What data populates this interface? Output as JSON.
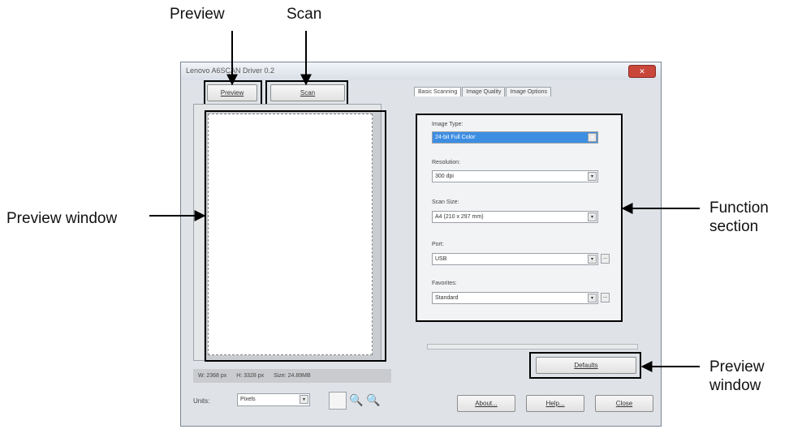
{
  "callouts": {
    "preview": "Preview",
    "scan": "Scan",
    "preview_window": "Preview window",
    "function_section_line1": "Function",
    "function_section_line2": "section",
    "preview_window2_line1": "Preview",
    "preview_window2_line2": "window"
  },
  "window": {
    "title": "Lenovo A6SCAN Driver 0.2",
    "close_glyph": "✕"
  },
  "toolbar": {
    "preview_label": "Preview",
    "scan_label": "Scan"
  },
  "status": {
    "width": "W: 2368 px",
    "height": "H: 3328 px",
    "size": "Size: 24.89MB"
  },
  "units": {
    "label": "Units:",
    "value": "Pixels"
  },
  "tabs": [
    "Basic Scanning",
    "Image Quality",
    "Image Options"
  ],
  "fields": {
    "image_type": {
      "label": "Image Type:",
      "value": "24-bit Full Color"
    },
    "resolution": {
      "label": "Resolution:",
      "value": "300 dpi"
    },
    "scan_size": {
      "label": "Scan Size:",
      "value": "A4 (210 x 297 mm)"
    },
    "port": {
      "label": "Port:",
      "value": "USB"
    },
    "favorites": {
      "label": "Favorites:",
      "value": "Standard"
    }
  },
  "buttons": {
    "defaults": "Defaults",
    "about": "About...",
    "help": "Help...",
    "close": "Close"
  },
  "icons": {
    "dropdown": "▾",
    "ellipsis": "...",
    "zoom_in": "🔍",
    "zoom_out": "🔍"
  }
}
